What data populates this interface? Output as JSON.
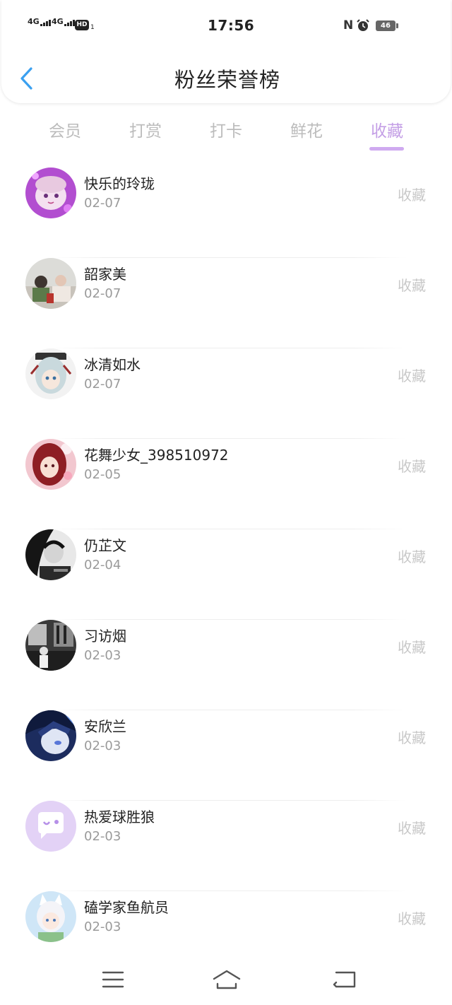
{
  "status_bar": {
    "signal1": "4G",
    "signal2": "4G",
    "hd": "HD",
    "hd_sub": "1",
    "time": "17:56",
    "nfc": "N",
    "battery": "46"
  },
  "header": {
    "title": "粉丝荣誉榜"
  },
  "tabs": [
    {
      "label": "会员",
      "active": false
    },
    {
      "label": "打赏",
      "active": false
    },
    {
      "label": "打卡",
      "active": false
    },
    {
      "label": "鲜花",
      "active": false
    },
    {
      "label": "收藏",
      "active": true
    }
  ],
  "colors": {
    "accent": "#c49fe6",
    "muted": "#bcbcbc",
    "action": "#c8c8c8"
  },
  "fans": [
    {
      "name": "快乐的玲珑",
      "date": "02-07",
      "action": "收藏",
      "avatar": "anime-purple-avatar"
    },
    {
      "name": "韶家美",
      "date": "02-07",
      "action": "收藏",
      "avatar": "family-photo-avatar"
    },
    {
      "name": "冰清如水",
      "date": "02-07",
      "action": "收藏",
      "avatar": "anime-white-hair-avatar"
    },
    {
      "name": "花舞少女_398510972",
      "date": "02-05",
      "action": "收藏",
      "avatar": "anime-red-hair-avatar"
    },
    {
      "name": "仍芷文",
      "date": "02-04",
      "action": "收藏",
      "avatar": "bw-portrait-avatar"
    },
    {
      "name": "习访烟",
      "date": "02-03",
      "action": "收藏",
      "avatar": "bw-street-avatar"
    },
    {
      "name": "安欣兰",
      "date": "02-03",
      "action": "收藏",
      "avatar": "anime-blue-avatar"
    },
    {
      "name": "热爱球胜狼",
      "date": "02-03",
      "action": "收藏",
      "avatar": "default-chat-avatar"
    },
    {
      "name": "磕学家鱼航员",
      "date": "02-03",
      "action": "收藏",
      "avatar": "anime-fox-girl-avatar"
    }
  ],
  "nav_bar": {
    "icons": [
      "menu-icon",
      "home-icon",
      "back-icon"
    ]
  }
}
